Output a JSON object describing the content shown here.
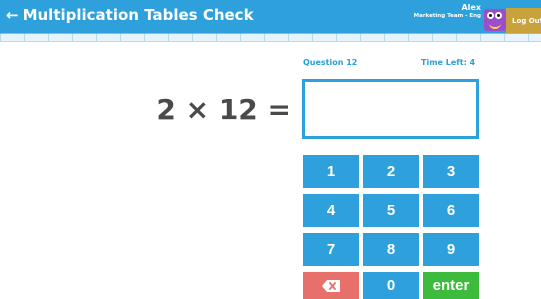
{
  "header": {
    "back_arrow": "←",
    "title": "Multiplication Tables Check",
    "user_name": "Alex",
    "user_team": "Marketing Team - Eng",
    "logout_label": "Log Out"
  },
  "question": {
    "label": "Question 12",
    "time_left": "Time Left: 4",
    "equation": "2 × 12 ="
  },
  "answer": {
    "value": ""
  },
  "keypad": {
    "keys": [
      "1",
      "2",
      "3",
      "4",
      "5",
      "6",
      "7",
      "8",
      "9"
    ],
    "zero": "0",
    "enter": "enter",
    "delete_icon": "backspace-icon"
  },
  "colors": {
    "primary": "#2ea1dc",
    "delete": "#e8706a",
    "enter": "#3dbb3d",
    "logout": "#c8a23a",
    "avatar": "#9b4dca"
  }
}
